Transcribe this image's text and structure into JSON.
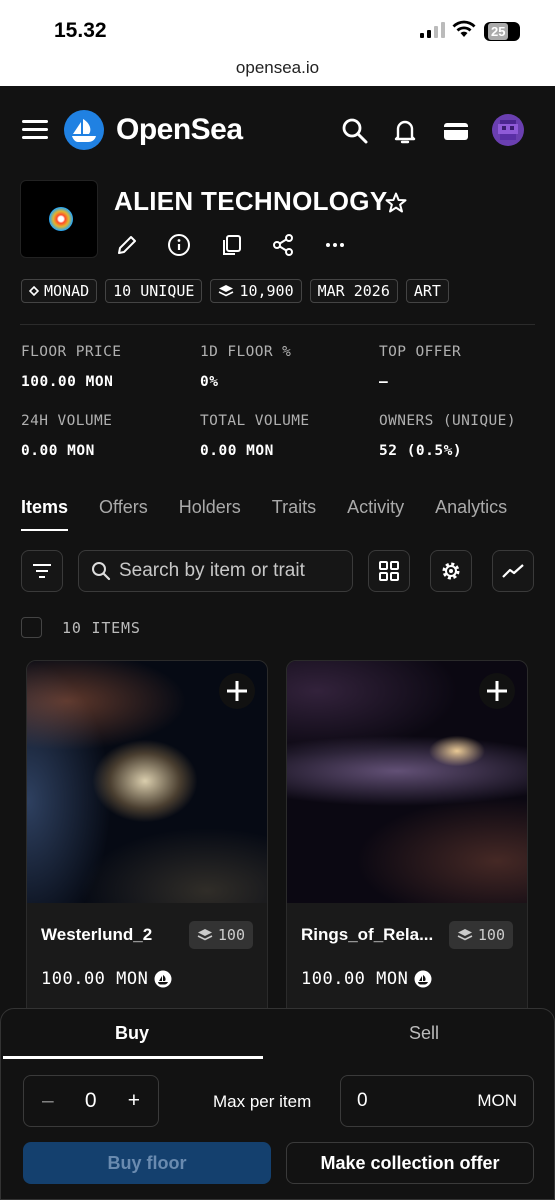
{
  "status_bar": {
    "time": "15.32",
    "battery": "25",
    "url": "opensea.io"
  },
  "header": {
    "brand": "OpenSea",
    "icons": [
      "menu-icon",
      "opensea-logo-icon",
      "search-icon",
      "bell-icon",
      "wallet-icon",
      "avatar"
    ]
  },
  "collection": {
    "name": "ALIEN TECHNOLOGY",
    "actions": [
      "edit-icon",
      "info-icon",
      "copy-icon",
      "share-icon",
      "more-icon"
    ],
    "tags": [
      "MONAD",
      "10 UNIQUE",
      "10,900",
      "MAR 2026",
      "ART"
    ]
  },
  "stats": [
    {
      "label": "FLOOR PRICE",
      "value": "100.00 MON"
    },
    {
      "label": "1D FLOOR %",
      "value": "0%"
    },
    {
      "label": "TOP OFFER",
      "value": "–"
    },
    {
      "label": "24H VOLUME",
      "value": "0.00 MON"
    },
    {
      "label": "TOTAL VOLUME",
      "value": "0.00 MON"
    },
    {
      "label": "OWNERS (UNIQUE)",
      "value": "52 (0.5%)"
    }
  ],
  "tabs": [
    "Items",
    "Offers",
    "Holders",
    "Traits",
    "Activity",
    "Analytics"
  ],
  "active_tab": "Items",
  "search": {
    "placeholder": "Search by item or trait"
  },
  "items_count": "10 ITEMS",
  "cards": [
    {
      "name": "Westerlund_2",
      "supply": "100",
      "price": "100.00 MON"
    },
    {
      "name": "Rings_of_Rela...",
      "supply": "100",
      "price": "100.00 MON"
    }
  ],
  "sheet": {
    "tab_buy": "Buy",
    "tab_sell": "Sell",
    "quantity": "0",
    "minus": "–",
    "plus": "+",
    "max_label": "Max per item",
    "max_value": "0",
    "max_unit": "MON",
    "buy_floor": "Buy floor",
    "collection_offer": "Make collection offer"
  },
  "colors": {
    "accent": "#2081e2",
    "buy_button": "#14406e",
    "background": "#121212"
  }
}
